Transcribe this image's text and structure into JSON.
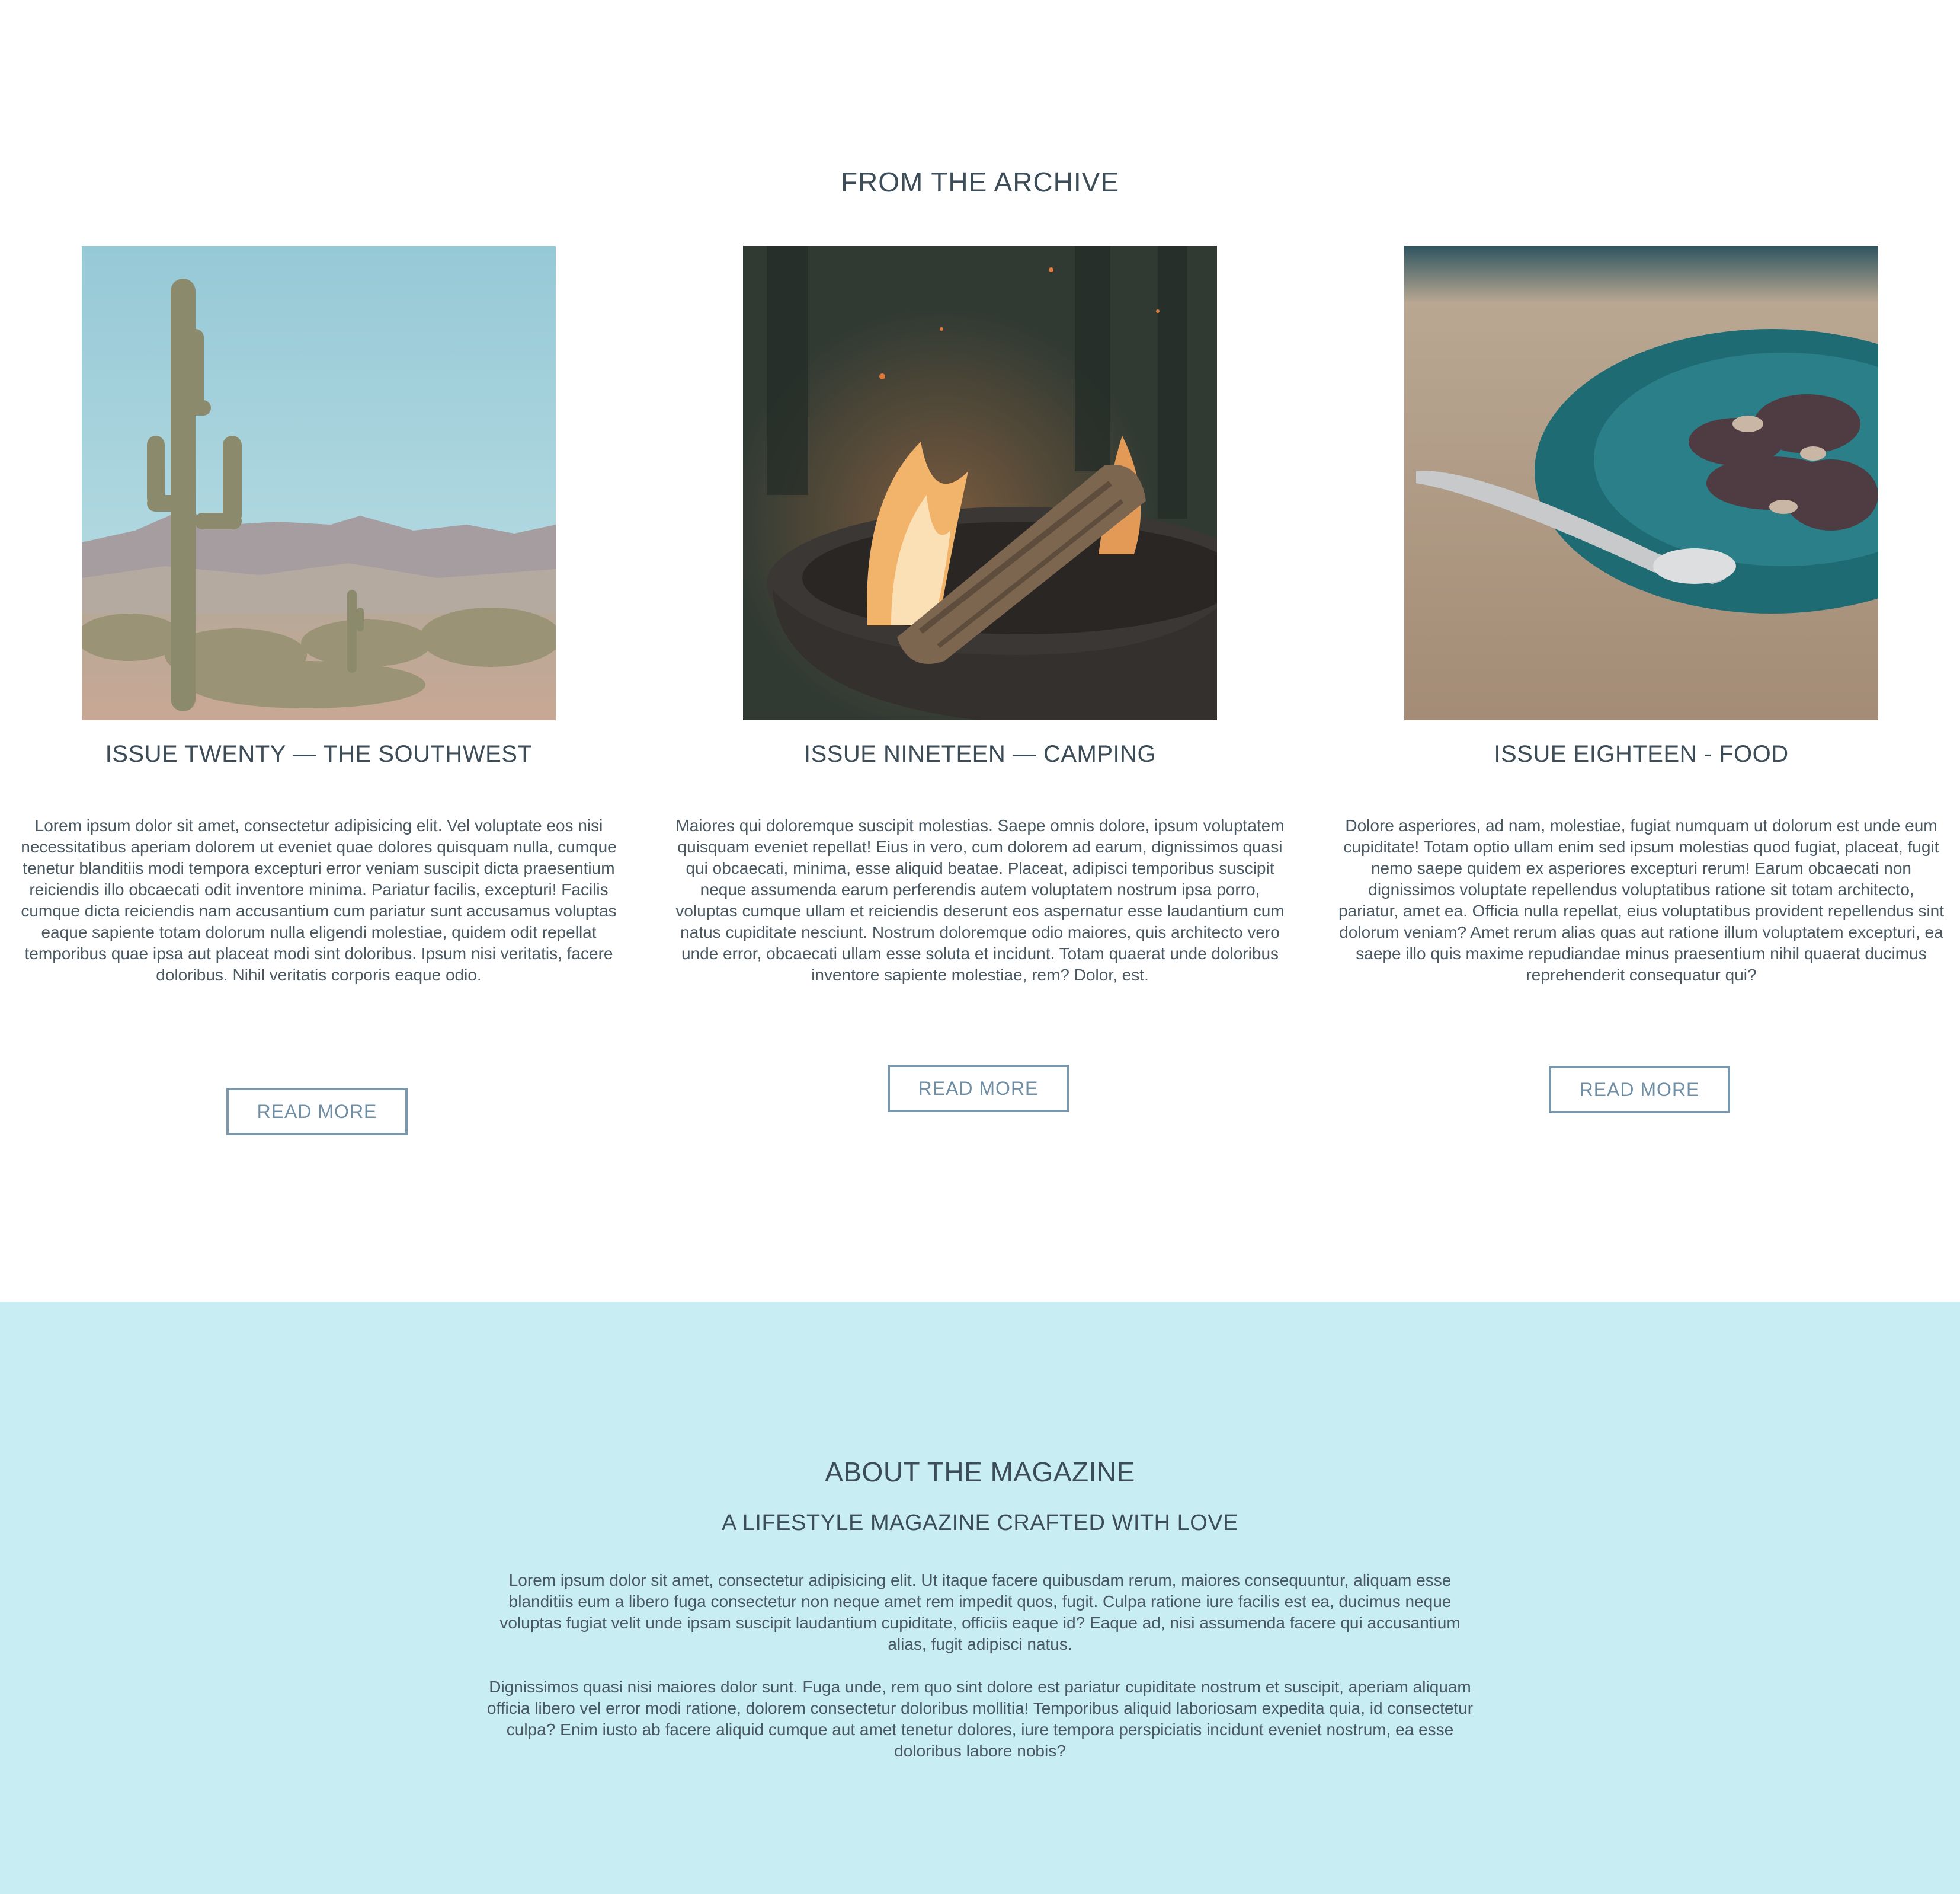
{
  "archive": {
    "title": "FROM THE ARCHIVE",
    "cards": [
      {
        "image_icon": "saguaro-cactus-desert-image",
        "title": "ISSUE TWENTY — THE SOUTHWEST",
        "text": "Lorem ipsum dolor sit amet, consectetur adipisicing elit. Vel voluptate eos nisi necessitatibus aperiam dolorem ut eveniet quae dolores quisquam nulla, cumque tenetur blanditiis modi tempora excepturi error veniam suscipit dicta praesentium reiciendis illo obcaecati odit inventore minima. Pariatur facilis, excepturi! Facilis cumque dicta reiciendis nam accusantium cum pariatur sunt accusamus voluptas eaque sapiente totam dolorum nulla eligendi molestiae, quidem odit repellat temporibus quae ipsa aut placeat modi sint doloribus. Ipsum nisi veritatis, facere doloribus. Nihil veritatis corporis eaque odio.",
        "button_label": "READ MORE"
      },
      {
        "image_icon": "campfire-image",
        "title": "ISSUE NINETEEN — CAMPING",
        "text": "Maiores qui doloremque suscipit molestias. Saepe omnis dolore, ipsum voluptatem quisquam eveniet repellat! Eius in vero, cum dolorem ad earum, dignissimos quasi qui obcaecati, minima, esse aliquid beatae. Placeat, adipisci temporibus suscipit neque assumenda earum perferendis autem voluptatem nostrum ipsa porro, voluptas cumque ullam et reiciendis deserunt eos aspernatur esse laudantium cum natus cupiditate nesciunt. Nostrum doloremque odio maiores, quis architecto vero unde error, obcaecati ullam esse soluta et incidunt. Totam quaerat unde doloribus inventore sapiente molestiae, rem? Dolor, est.",
        "button_label": "READ MORE"
      },
      {
        "image_icon": "plate-of-food-image",
        "title": "ISSUE EIGHTEEN - FOOD",
        "text": "Dolore asperiores, ad nam, molestiae, fugiat numquam ut dolorum est unde eum cupiditate! Totam optio ullam enim sed ipsum molestias quod fugiat, placeat, fugit nemo saepe quidem ex asperiores excepturi rerum! Earum obcaecati non dignissimos voluptate repellendus voluptatibus ratione sit totam architecto, pariatur, amet ea. Officia nulla repellat, eius voluptatibus provident repellendus sint dolorum veniam? Amet rerum alias quas aut ratione illum voluptatem excepturi, ea saepe illo quis maxime repudiandae minus praesentium nihil quaerat ducimus reprehenderit consequatur qui?",
        "button_label": "READ MORE"
      }
    ]
  },
  "about": {
    "title": "ABOUT THE MAGAZINE",
    "subtitle": "A LIFESTYLE MAGAZINE CRAFTED WITH LOVE",
    "paragraphs": [
      "Lorem ipsum dolor sit amet, consectetur adipisicing elit. Ut itaque facere quibusdam rerum, maiores consequuntur, aliquam esse blanditiis eum a libero fuga consectetur non neque amet rem impedit quos, fugit. Culpa ratione iure facilis est ea, ducimus neque voluptas fugiat velit unde ipsam suscipit laudantium cupiditate, officiis eaque id? Eaque ad, nisi assumenda facere qui accusantium alias, fugit adipisci natus.",
      "Dignissimos quasi nisi maiores dolor sunt. Fuga unde, rem quo sint dolore est pariatur cupiditate nostrum et suscipit, aperiam aliquam officia libero vel error modi ratione, dolorem consectetur doloribus mollitia! Temporibus aliquid laboriosam expedita quia, id consectetur culpa? Enim iusto ab facere aliquid cumque aut amet tenetur dolores, iure tempora perspiciatis incidunt eveniet nostrum, ea esse doloribus labore nobis?"
    ]
  },
  "colors": {
    "heading": "#3d4d58",
    "body_text": "#4a5862",
    "button_border": "#7a97ab",
    "button_text": "#6f8ea3",
    "about_background": "#c8eef4"
  }
}
